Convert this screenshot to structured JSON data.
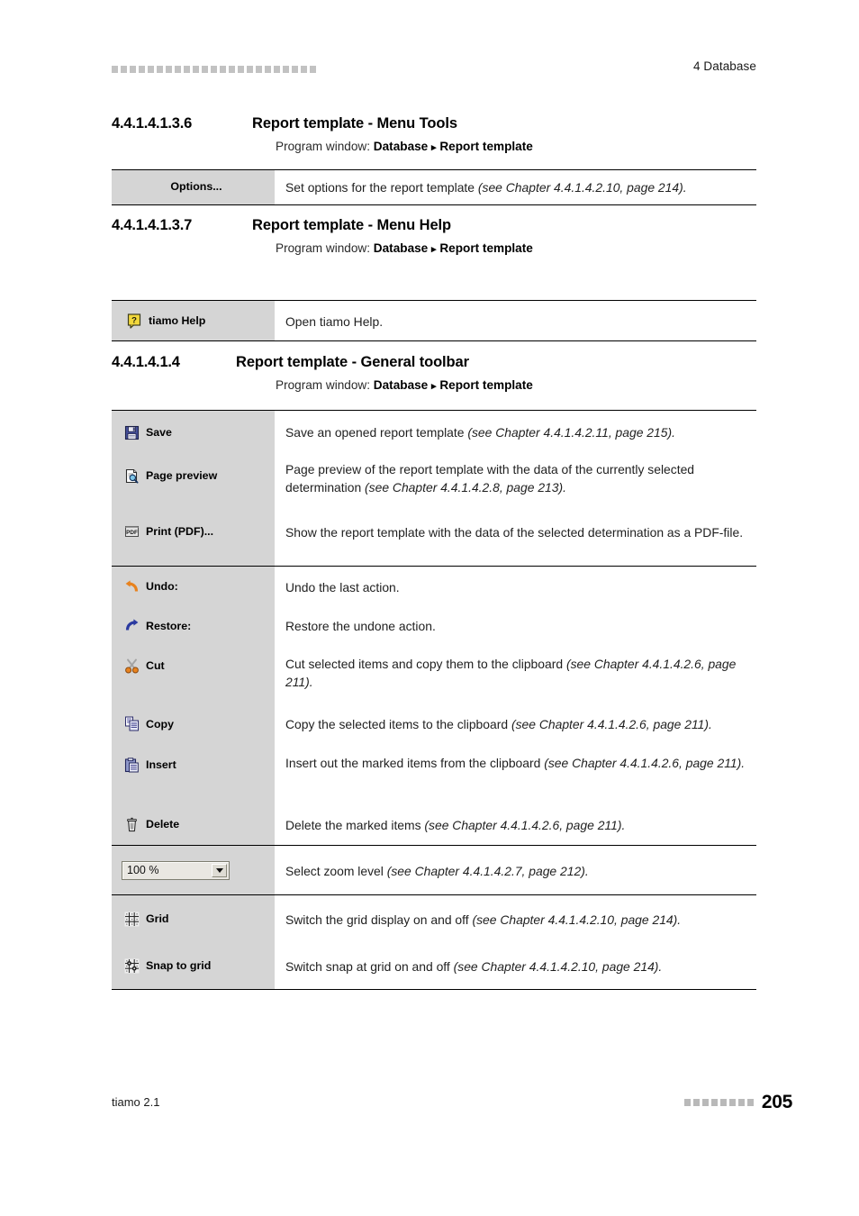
{
  "header": {
    "decoration_squares": 23,
    "title": "4 Database"
  },
  "sections": [
    {
      "number": "4.4.1.4.1.3.6",
      "title": "Report template - Menu Tools",
      "subtitle_prefix": "Program window:",
      "subtitle_path_1": "Database",
      "subtitle_arrow": "▸",
      "subtitle_path_2": "Report template",
      "rows": [
        {
          "icon": "none",
          "label": "Options...",
          "desc_plain": "Set options for the report template ",
          "desc_italic": "(see Chapter 4.4.1.4.2.10, page 214)."
        }
      ]
    },
    {
      "number": "4.4.1.4.1.3.7",
      "title": "Report template - Menu Help",
      "subtitle_prefix": "Program window:",
      "subtitle_path_1": "Database",
      "subtitle_arrow": "▸",
      "subtitle_path_2": "Report template",
      "rows": [
        {
          "icon": "help-bubble-icon",
          "label": "tiamo Help",
          "desc_plain": "Open tiamo Help.",
          "desc_italic": ""
        }
      ]
    },
    {
      "number": "4.4.1.4.1.4",
      "title": "Report template - General toolbar",
      "subtitle_prefix": "Program window:",
      "subtitle_path_1": "Database",
      "subtitle_arrow": "▸",
      "subtitle_path_2": "Report template",
      "rows": [
        {
          "icon": "save-floppy-icon",
          "label": "Save",
          "desc_plain": "Save an opened report template ",
          "desc_italic": "(see Chapter 4.4.1.4.2.11, page 215)."
        },
        {
          "icon": "page-preview-icon",
          "label": "Page preview",
          "desc_plain": "Page preview of the report template with the data of the currently selected determination ",
          "desc_italic": "(see Chapter 4.4.1.4.2.8, page 213)."
        },
        {
          "icon": "pdf-icon",
          "label": "Print (PDF)...",
          "desc_plain": "Show the report template with the data of the selected determination as a PDF-file.",
          "desc_italic": ""
        },
        {
          "icon": "undo-icon",
          "label": "Undo:",
          "desc_plain": "Undo the last action.",
          "desc_italic": ""
        },
        {
          "icon": "redo-icon",
          "label": "Restore:",
          "desc_plain": "Restore the undone action.",
          "desc_italic": ""
        },
        {
          "icon": "scissors-icon",
          "label": "Cut",
          "desc_plain": "Cut selected items and copy them to the clipboard ",
          "desc_italic": "(see Chapter 4.4.1.4.2.6, page 211)."
        },
        {
          "icon": "copy-icon",
          "label": "Copy",
          "desc_plain": "Copy the selected items to the clipboard ",
          "desc_italic": "(see Chapter 4.4.1.4.2.6, page 211)."
        },
        {
          "icon": "paste-icon",
          "label": "Insert",
          "desc_plain": "Insert out the marked items from the clipboard ",
          "desc_italic": "(see Chapter 4.4.1.4.2.6, page 211)."
        },
        {
          "icon": "trash-icon",
          "label": "Delete",
          "desc_plain": "Delete the marked items ",
          "desc_italic": "(see Chapter 4.4.1.4.2.6, page 211)."
        },
        {
          "icon": "zoom-combo",
          "label": "100 %",
          "desc_plain": "Select zoom level ",
          "desc_italic": "(see Chapter 4.4.1.4.2.7, page 212)."
        },
        {
          "icon": "grid-icon",
          "label": "Grid",
          "desc_plain": "Switch the grid display on and off ",
          "desc_italic": "(see Chapter 4.4.1.4.2.10, page 214)."
        },
        {
          "icon": "snap-to-grid-icon",
          "label": "Snap to grid",
          "desc_plain": "Switch snap at grid on and off ",
          "desc_italic": "(see Chapter 4.4.1.4.2.10, page 214)."
        }
      ]
    }
  ],
  "footer": {
    "product": "tiamo 2.1",
    "decoration_squares": 8,
    "page_number": "205"
  },
  "colors": {
    "gray_cell": "#d5d5d5",
    "rule": "#000000",
    "square_header": "#c2c2c2",
    "square_footer": "#b9b9b9"
  }
}
